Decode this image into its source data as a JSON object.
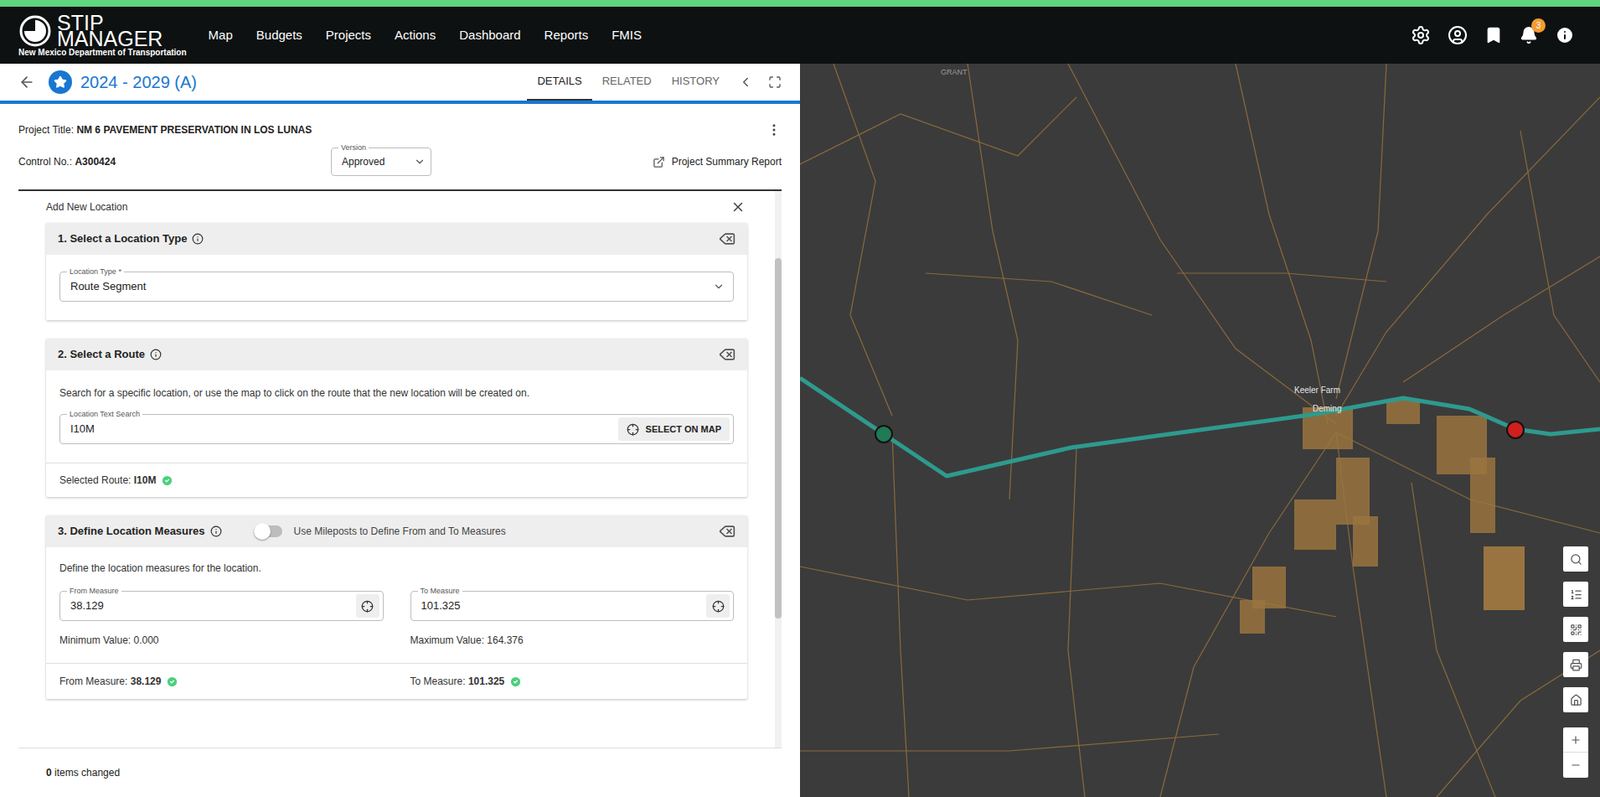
{
  "header": {
    "logo_lines": [
      "STIP",
      "MANAGER"
    ],
    "logo_subtitle": "New Mexico Department of Transportation",
    "nav": [
      "Map",
      "Budgets",
      "Projects",
      "Actions",
      "Dashboard",
      "Reports",
      "FMIS"
    ],
    "notification_count": "3"
  },
  "record": {
    "title": "2024 - 2029 (A)",
    "tabs": [
      {
        "label": "DETAILS",
        "selected": true
      },
      {
        "label": "RELATED",
        "selected": false
      },
      {
        "label": "HISTORY",
        "selected": false
      }
    ]
  },
  "project": {
    "title_label": "Project Title:",
    "title": "NM 6 PAVEMENT PRESERVATION IN LOS LUNAS",
    "control_label": "Control No.:",
    "control": "A300424",
    "version_label": "Version",
    "version": "Approved",
    "report_link": "Project Summary Report"
  },
  "form": {
    "title": "Add New Location",
    "section1": {
      "title": "1. Select a Location Type",
      "field_label": "Location Type *",
      "field_value": "Route Segment"
    },
    "section2": {
      "title": "2. Select a Route",
      "description": "Search for a specific location, or use the map to click on the route that the new location will be created on.",
      "field_label": "Location Text Search",
      "field_value": "I10M",
      "button": "SELECT ON MAP",
      "selected_label": "Selected Route:",
      "selected_value": "I10M",
      "valid": true
    },
    "section3": {
      "title": "3. Define Location Measures",
      "toggle_label": "Use Mileposts to Define From and To Measures",
      "toggle_on": false,
      "description": "Define the location measures for the location.",
      "from": {
        "label": "From Measure",
        "value": "38.129",
        "limit": "Minimum Value: 0.000",
        "summary_label": "From Measure:",
        "valid": true
      },
      "to": {
        "label": "To Measure",
        "value": "101.325",
        "limit": "Maximum Value: 164.376",
        "summary_label": "To Measure:",
        "valid": true
      }
    }
  },
  "footer": {
    "count": "0",
    "text": "items changed"
  },
  "map": {
    "labels": [
      "GRANT",
      "Keeler Farm",
      "Deming"
    ]
  }
}
